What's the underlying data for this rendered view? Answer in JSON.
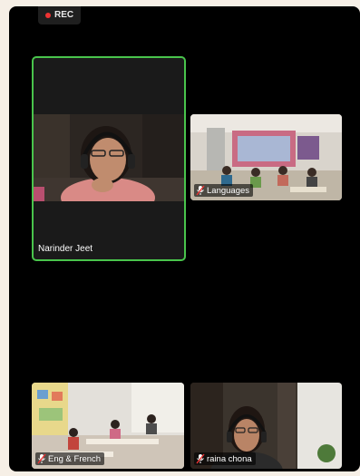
{
  "recording": {
    "label": "REC"
  },
  "participants": [
    {
      "name": "Narinder Jeet",
      "active": true
    },
    {
      "name": "Languages",
      "muted": true
    },
    {
      "name": "Eng & French",
      "muted": true
    },
    {
      "name": "raina chona",
      "muted": true
    }
  ],
  "colors": {
    "active_border": "#49c44c",
    "rec_dot": "#e33333",
    "background": "#000000"
  }
}
